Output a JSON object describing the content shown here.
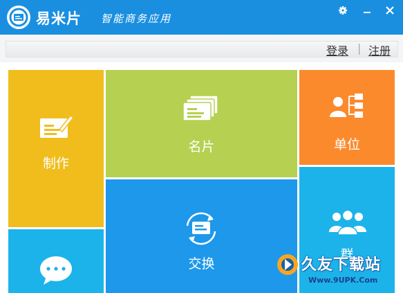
{
  "header": {
    "app_name": "易米片",
    "tagline": "智能商务应用",
    "settings_icon": "gear-icon",
    "minimize_icon": "minimize-icon",
    "close_icon": "close-icon"
  },
  "auth": {
    "login": "登录",
    "separator": "|",
    "register": "注册"
  },
  "tiles": {
    "make": {
      "label": "制作",
      "color": "#f0bd1c",
      "icon": "edit-card-icon"
    },
    "cards": {
      "label": "名片",
      "color": "#b6d052",
      "icon": "cards-stack-icon"
    },
    "unit": {
      "label": "单位",
      "color": "#fb8a2d",
      "icon": "org-chart-icon"
    },
    "exchange": {
      "label": "交换",
      "color": "#1d98ea",
      "icon": "exchange-card-icon"
    },
    "group": {
      "label": "群",
      "color": "#1cb3ea",
      "icon": "group-people-icon"
    },
    "message": {
      "label": "",
      "color": "#1cb3ea",
      "icon": "chat-bubble-icon"
    }
  },
  "watermark": {
    "text": "久友下载站",
    "url": "Www.9UPK.Com"
  }
}
